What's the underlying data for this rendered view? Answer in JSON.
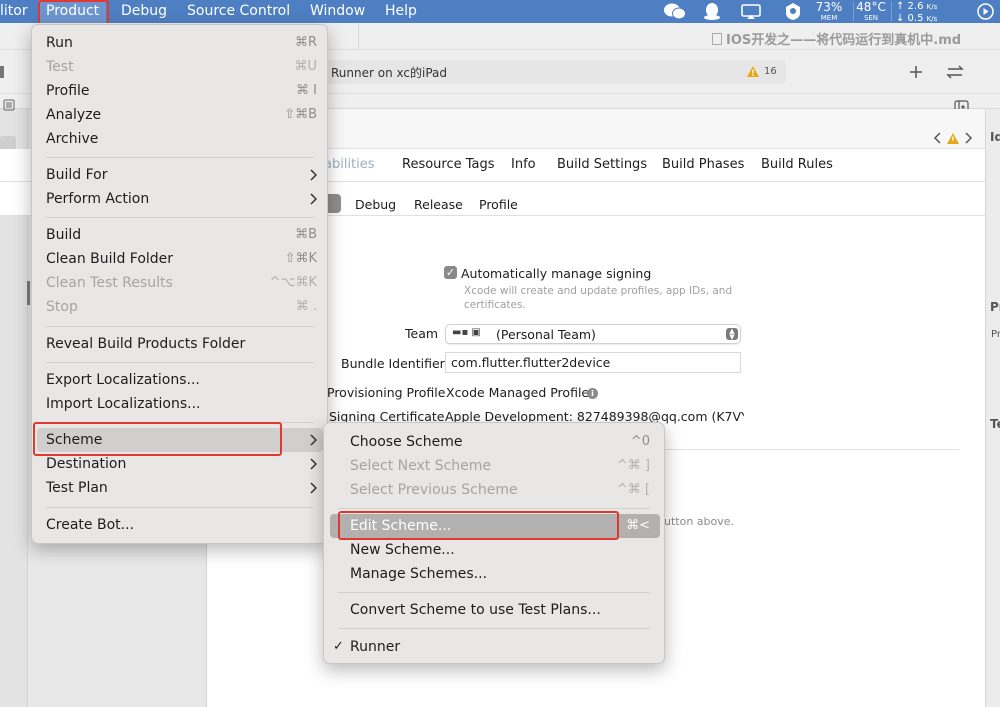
{
  "menubar": {
    "items": [
      "litor",
      "Product",
      "Debug",
      "Source Control",
      "Window",
      "Help"
    ],
    "status": {
      "mem_pct": "73%",
      "mem_label": "MEM",
      "temp": "48°C",
      "temp_label": "SEN",
      "up": "↑ 2.6",
      "down": "↓ 0.5",
      "rate_unit": "K/s"
    }
  },
  "document_title": "IOS开发之——将代码运行到真机中.md",
  "toolbar": {
    "scheme_target": "Runner on xc的iPad",
    "warning_count": "16"
  },
  "tabs": [
    "abilities",
    "Resource Tags",
    "Info",
    "Build Settings",
    "Build Phases",
    "Build Rules"
  ],
  "configs": [
    "Debug",
    "Release",
    "Profile"
  ],
  "signing": {
    "auto_label": "Automatically manage signing",
    "auto_note": "Xcode will create and update profiles, app IDs, and certificates.",
    "team_label": "Team",
    "team_value": "(Personal Team)",
    "bundle_label": "Bundle Identifier",
    "bundle_value": "com.flutter.flutter2device",
    "profile_label": "Provisioning Profile",
    "profile_value": "Xcode Managed Profile",
    "cert_label": "Signing Certificate",
    "cert_value": "Apple Development: 827489398@qq.com (K7VY...",
    "hint_text": "utton above."
  },
  "inspector": {
    "id": "Id",
    "pr1": "Pr",
    "pr2": "Pr",
    "te": "Te"
  },
  "product_menu": {
    "run": "Run",
    "run_sc": "⌘R",
    "test": "Test",
    "test_sc": "⌘U",
    "profile": "Profile",
    "profile_sc": "⌘ I",
    "analyze": "Analyze",
    "analyze_sc": "⇧⌘B",
    "archive": "Archive",
    "build_for": "Build For",
    "perform_action": "Perform Action",
    "build": "Build",
    "build_sc": "⌘B",
    "clean_build_folder": "Clean Build Folder",
    "clean_sc": "⇧⌘K",
    "clean_test_results": "Clean Test Results",
    "clean_test_sc": "^⌥⌘K",
    "stop": "Stop",
    "stop_sc": "⌘ .",
    "reveal": "Reveal Build Products Folder",
    "export_loc": "Export Localizations...",
    "import_loc": "Import Localizations...",
    "scheme": "Scheme",
    "destination": "Destination",
    "test_plan": "Test Plan",
    "create_bot": "Create Bot..."
  },
  "scheme_menu": {
    "choose": "Choose Scheme",
    "choose_sc": "^0",
    "next": "Select Next Scheme",
    "next_sc": "^⌘ ]",
    "prev": "Select Previous Scheme",
    "prev_sc": "^⌘ [",
    "edit": "Edit Scheme...",
    "edit_sc": "⌘<",
    "new": "New Scheme...",
    "manage": "Manage Schemes...",
    "convert": "Convert Scheme to use Test Plans...",
    "runner": "Runner",
    "check": "✓"
  },
  "colors": {
    "menubar": "#4f7fc3",
    "highlight_red": "#e03a30",
    "warning": "#e6a817"
  }
}
